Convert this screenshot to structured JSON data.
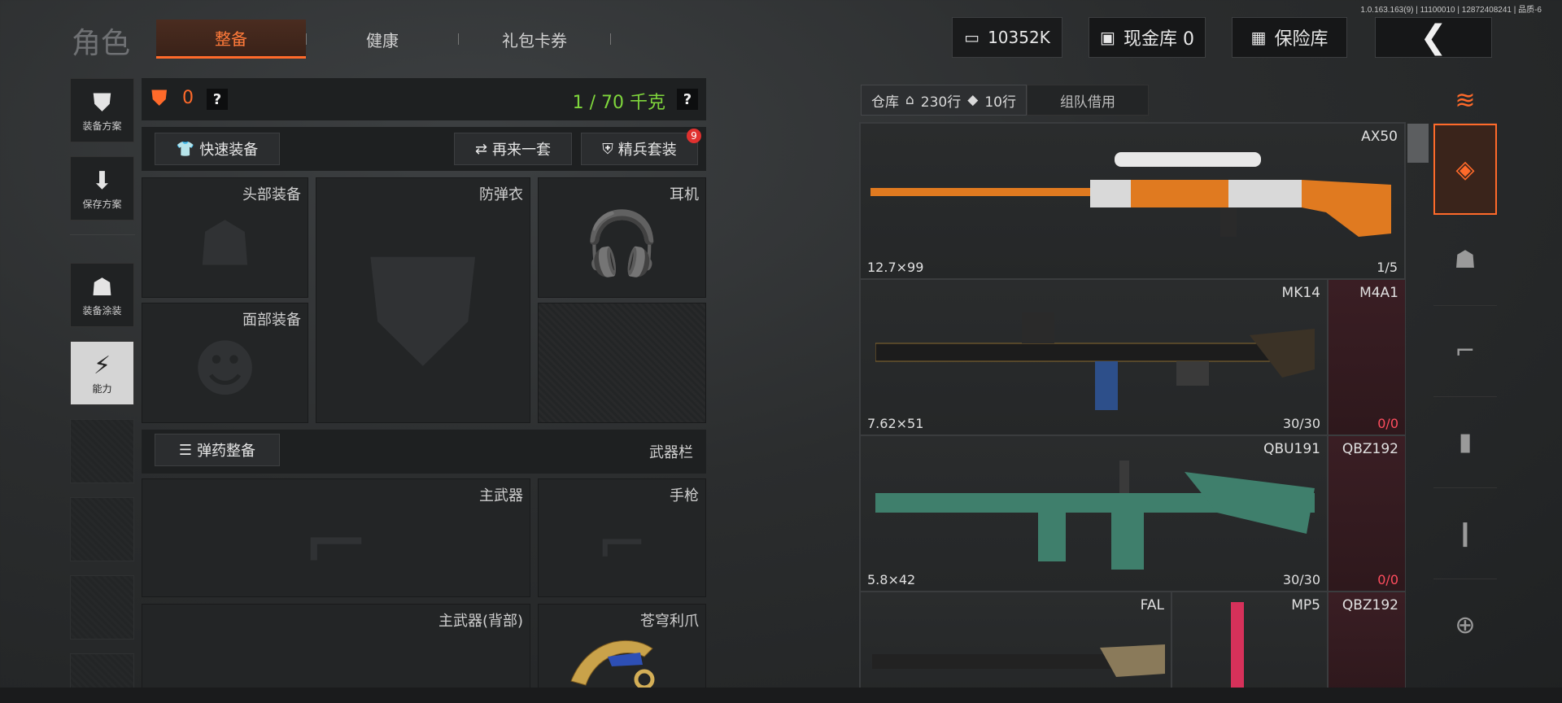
{
  "build_info": "1.0.163.163(9) | 11100010 | 12872408241 | 品质-6",
  "page_title": "角色",
  "tabs": [
    {
      "label": "整备",
      "active": true
    },
    {
      "label": "健康",
      "active": false
    },
    {
      "label": "礼包卡券",
      "active": false
    }
  ],
  "top": {
    "currency": "10352K",
    "cash_vault": "现金库 0",
    "safe": "保险库",
    "back_icon": "chevron-left-icon"
  },
  "left_nav": [
    {
      "label": "装备方案",
      "icon": "vest-icon"
    },
    {
      "label": "保存方案",
      "icon": "download-icon"
    },
    {
      "label": "装备涂装",
      "icon": "helmet-paint-icon"
    },
    {
      "label": "能力",
      "icon": "ability-icon"
    }
  ],
  "loadout": {
    "armor_count": "0",
    "weight": "1 / 70 千克",
    "quick_equip": "快速装备",
    "repeat": "再来一套",
    "elite": "精兵套装",
    "elite_badge": "9",
    "slots": {
      "head": "头部装备",
      "armor": "防弹衣",
      "headset": "耳机",
      "face": "面部装备"
    },
    "ammo_btn": "弹药整备",
    "weapon_bar": "武器栏",
    "weapon_slots": {
      "primary": "主武器",
      "pistol": "手枪",
      "primary_back": "主武器(背部)",
      "melee": "苍穹利爪"
    }
  },
  "warehouse": {
    "tab": "仓库",
    "rows1": "230行",
    "rows2": "10行",
    "team": "组队借用",
    "items": [
      {
        "name": "AX50",
        "caliber": "12.7×99",
        "count": "1/5"
      },
      {
        "name": "MK14",
        "caliber": "7.62×51",
        "count": "30/30"
      },
      {
        "name": "M4A1",
        "caliber": "",
        "count": "0/0"
      },
      {
        "name": "QBU191",
        "caliber": "5.8×42",
        "count": "30/30"
      },
      {
        "name": "QBZ192",
        "caliber": "",
        "count": "0/0"
      },
      {
        "name": "FAL",
        "caliber": "",
        "count": ""
      },
      {
        "name": "MP5",
        "caliber": "",
        "count": ""
      },
      {
        "name": "QBZ192",
        "caliber": "",
        "count": ""
      }
    ]
  },
  "right_bar": [
    "layers-refresh-icon",
    "layers-icon",
    "helmet-icon",
    "rifle-icon",
    "magazine-icon",
    "bullet-icon",
    "scope-icon"
  ],
  "colors": {
    "accent": "#ff6a2a",
    "weight_green": "#7fd63c",
    "ammo_red": "#ff4d5e"
  }
}
